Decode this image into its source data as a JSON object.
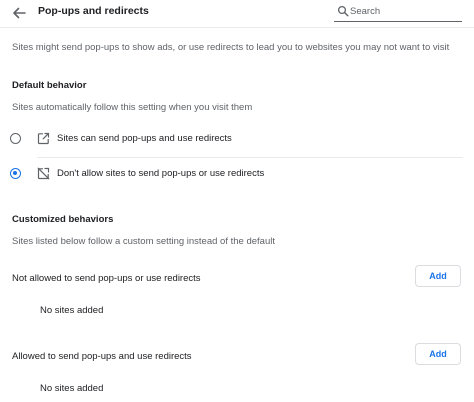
{
  "header": {
    "back_icon": "arrow-back-icon",
    "title": "Pop-ups and redirects",
    "search": {
      "icon": "search-icon",
      "placeholder": "Search",
      "value": ""
    }
  },
  "description": "Sites might send pop-ups to show ads, or use redirects to lead you to websites you may not want to visit",
  "default_behavior": {
    "heading": "Default behavior",
    "subtext": "Sites automatically follow this setting when you visit them",
    "options": [
      {
        "label": "Sites can send pop-ups and use redirects",
        "icon": "open-in-new-icon",
        "selected": false
      },
      {
        "label": "Don't allow sites to send pop-ups or use redirects",
        "icon": "popup-blocked-icon",
        "selected": true
      }
    ]
  },
  "customized": {
    "heading": "Customized behaviors",
    "subtext": "Sites listed below follow a custom setting instead of the default",
    "lists": [
      {
        "label": "Not allowed to send pop-ups or use redirects",
        "add_label": "Add",
        "empty_text": "No sites added"
      },
      {
        "label": "Allowed to send pop-ups and use redirects",
        "add_label": "Add",
        "empty_text": "No sites added"
      }
    ]
  },
  "colors": {
    "accent": "#1a73e8",
    "secondary_text": "#5f6368",
    "primary_text": "#202124",
    "divider": "#e8eaed"
  }
}
